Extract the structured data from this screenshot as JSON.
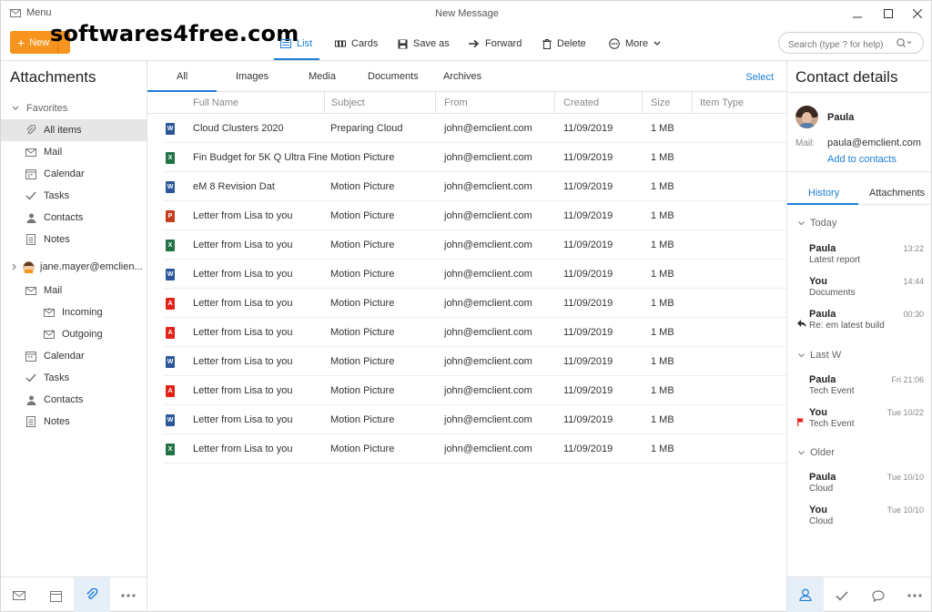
{
  "window": {
    "menu_label": "Menu",
    "title": "New Message",
    "controls": [
      "minimize-icon",
      "maximize-icon",
      "close-icon"
    ]
  },
  "watermark": "softwares4free.com",
  "toolbar": {
    "new_label": "New",
    "items": [
      {
        "label": "List",
        "icon": "list-icon",
        "active": true
      },
      {
        "label": "Cards",
        "icon": "cards-icon"
      },
      {
        "label": "Save as",
        "icon": "save-icon"
      },
      {
        "label": "Forward",
        "icon": "forward-arrow-icon"
      },
      {
        "label": "Delete",
        "icon": "trash-icon"
      },
      {
        "label": "More",
        "icon": "more-icon"
      }
    ],
    "search_placeholder": "Search (type ? for help)"
  },
  "sidebar": {
    "title": "Attachments",
    "favorites_label": "Favorites",
    "favorites": [
      {
        "label": "All items",
        "icon": "paperclip-icon",
        "selected": true
      },
      {
        "label": "Mail",
        "icon": "mail-icon"
      },
      {
        "label": "Calendar",
        "icon": "calendar-icon"
      },
      {
        "label": "Tasks",
        "icon": "check-icon"
      },
      {
        "label": "Contacts",
        "icon": "person-icon"
      },
      {
        "label": "Notes",
        "icon": "note-icon"
      }
    ],
    "account_label": "jane.mayer@emclien...",
    "account_items": [
      {
        "label": "Mail",
        "icon": "mail-icon"
      },
      {
        "label": "Incoming",
        "icon": "inbox-icon"
      },
      {
        "label": "Outgoing",
        "icon": "outbox-icon"
      },
      {
        "label": "Calendar",
        "icon": "calendar-icon"
      },
      {
        "label": "Tasks",
        "icon": "check-icon"
      },
      {
        "label": "Contacts",
        "icon": "person-icon"
      },
      {
        "label": "Notes",
        "icon": "note-icon"
      }
    ],
    "bottom_nav": [
      "mail-icon",
      "calendar-icon",
      "paperclip-icon",
      "more-dots-icon"
    ]
  },
  "main": {
    "tabs": [
      "All",
      "Images",
      "Media",
      "Documents",
      "Archives"
    ],
    "select_label": "Select",
    "columns": [
      "Full Name",
      "Subject",
      "From",
      "Created",
      "Size",
      "Item Type"
    ],
    "rows": [
      {
        "type": "word",
        "name": "Cloud Clusters 2020",
        "subject": "Preparing Cloud",
        "from": "john@emclient.com",
        "created": "11/09/2019",
        "size": "1 MB"
      },
      {
        "type": "excel",
        "name": "Fin Budget for 5K Q Ultra Fine",
        "subject": "Motion Picture",
        "from": "john@emclient.com",
        "created": "11/09/2019",
        "size": "1 MB"
      },
      {
        "type": "word",
        "name": "eM 8 Revision Dat",
        "subject": "Motion Picture",
        "from": "john@emclient.com",
        "created": "11/09/2019",
        "size": "1 MB"
      },
      {
        "type": "ppt",
        "name": "Letter from Lisa to you",
        "subject": "Motion Picture",
        "from": "john@emclient.com",
        "created": "11/09/2019",
        "size": "1 MB"
      },
      {
        "type": "excel",
        "name": "Letter from Lisa to you",
        "subject": "Motion Picture",
        "from": "john@emclient.com",
        "created": "11/09/2019",
        "size": "1 MB"
      },
      {
        "type": "word",
        "name": "Letter from Lisa to you",
        "subject": "Motion Picture",
        "from": "john@emclient.com",
        "created": "11/09/2019",
        "size": "1 MB"
      },
      {
        "type": "pdf",
        "name": "Letter from Lisa to you",
        "subject": "Motion Picture",
        "from": "john@emclient.com",
        "created": "11/09/2019",
        "size": "1 MB"
      },
      {
        "type": "pdf",
        "name": "Letter from Lisa to you",
        "subject": "Motion Picture",
        "from": "john@emclient.com",
        "created": "11/09/2019",
        "size": "1 MB"
      },
      {
        "type": "word",
        "name": "Letter from Lisa to you",
        "subject": "Motion Picture",
        "from": "john@emclient.com",
        "created": "11/09/2019",
        "size": "1 MB"
      },
      {
        "type": "pdf",
        "name": "Letter from Lisa to you",
        "subject": "Motion Picture",
        "from": "john@emclient.com",
        "created": "11/09/2019",
        "size": "1 MB"
      },
      {
        "type": "word",
        "name": "Letter from Lisa to you",
        "subject": "Motion Picture",
        "from": "john@emclient.com",
        "created": "11/09/2019",
        "size": "1 MB"
      },
      {
        "type": "excel",
        "name": "Letter from Lisa to you",
        "subject": "Motion Picture",
        "from": "john@emclient.com",
        "created": "11/09/2019",
        "size": "1 MB"
      }
    ]
  },
  "contact": {
    "title": "Contact details",
    "name": "Paula",
    "mail_label": "Mail:",
    "email": "paula@emclient.com",
    "add_label": "Add to contacts",
    "tabs": [
      "History",
      "Attachments"
    ],
    "groups": [
      {
        "label": "Today",
        "items": [
          {
            "who": "Paula",
            "time": "13:22",
            "sub": "Latest report",
            "mark": ""
          },
          {
            "who": "You",
            "time": "14:44",
            "sub": "Documents",
            "mark": ""
          },
          {
            "who": "Paula",
            "time": "00:30",
            "sub": "Re: em latest build",
            "mark": "reply"
          }
        ]
      },
      {
        "label": "Last W",
        "items": [
          {
            "who": "Paula",
            "time": "Fri 21:06",
            "sub": "Tech Event",
            "mark": ""
          },
          {
            "who": "You",
            "time": "Tue 10/22",
            "sub": "Tech Event",
            "mark": "flag"
          }
        ]
      },
      {
        "label": "Older",
        "items": [
          {
            "who": "Paula",
            "time": "Tue 10/10",
            "sub": "Cloud",
            "mark": ""
          },
          {
            "who": "You",
            "time": "Tue 10/10",
            "sub": "Cloud",
            "mark": ""
          }
        ]
      }
    ],
    "bottom_nav": [
      "person-icon",
      "check-icon",
      "chat-bubble-icon",
      "more-dots-icon"
    ]
  },
  "colors": {
    "accent": "#1c7ed6",
    "new_button": "#f7941d",
    "word": "#2b579a",
    "excel": "#217346",
    "ppt": "#c43e1c",
    "pdf": "#e2231a"
  }
}
